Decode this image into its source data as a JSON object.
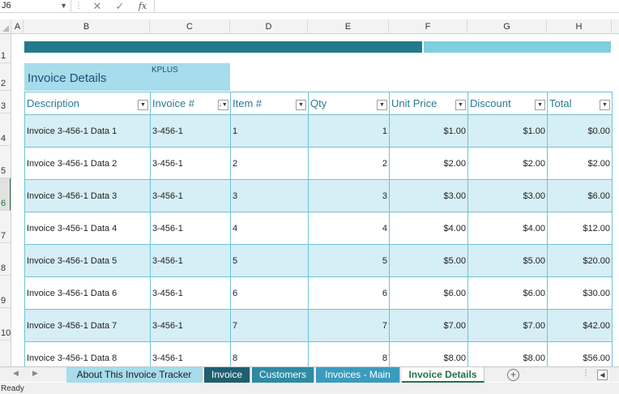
{
  "formula_bar": {
    "name_box": "J6",
    "cancel_icon": "✕",
    "enter_icon": "✓",
    "fx_label": "fx",
    "formula": ""
  },
  "columns": [
    "A",
    "B",
    "C",
    "D",
    "E",
    "F",
    "G",
    "H"
  ],
  "rows": [
    "1",
    "2",
    "3",
    "4",
    "5",
    "6",
    "7",
    "8",
    "9",
    "10"
  ],
  "active_row": "6",
  "sheet": {
    "title": "Invoice Details",
    "brand": "KPLUS",
    "headers": [
      "Description",
      "Invoice #",
      "Item #",
      "Qty",
      "Unit Price",
      "Discount",
      "Total"
    ],
    "rows": [
      [
        "Invoice 3-456-1 Data 1",
        "3-456-1",
        "1",
        "1",
        "$1.00",
        "$1.00",
        "$0.00"
      ],
      [
        "Invoice 3-456-1 Data 2",
        "3-456-1",
        "2",
        "2",
        "$2.00",
        "$2.00",
        "$2.00"
      ],
      [
        "Invoice 3-456-1 Data 3",
        "3-456-1",
        "3",
        "3",
        "$3.00",
        "$3.00",
        "$6.00"
      ],
      [
        "Invoice 3-456-1 Data 4",
        "3-456-1",
        "4",
        "4",
        "$4.00",
        "$4.00",
        "$12.00"
      ],
      [
        "Invoice 3-456-1 Data 5",
        "3-456-1",
        "5",
        "5",
        "$5.00",
        "$5.00",
        "$20.00"
      ],
      [
        "Invoice 3-456-1 Data 6",
        "3-456-1",
        "6",
        "6",
        "$6.00",
        "$6.00",
        "$30.00"
      ],
      [
        "Invoice 3-456-1 Data 7",
        "3-456-1",
        "7",
        "7",
        "$7.00",
        "$7.00",
        "$42.00"
      ],
      [
        "Invoice 3-456-1 Data 8",
        "3-456-1",
        "8",
        "8",
        "$8.00",
        "$8.00",
        "$56.00"
      ]
    ]
  },
  "tabs": [
    {
      "label": "About This Invoice Tracker",
      "style": "about"
    },
    {
      "label": "Invoice",
      "style": "dark"
    },
    {
      "label": "Customers",
      "style": "mid"
    },
    {
      "label": "Invoices - Main",
      "style": "mid2"
    },
    {
      "label": "Invoice Details",
      "style": "active"
    }
  ],
  "status": "Ready",
  "colors": {
    "accent_dark": "#217a8a",
    "accent_light": "#7fcfe0",
    "band": "#d6eef5",
    "excel_green": "#217346"
  }
}
